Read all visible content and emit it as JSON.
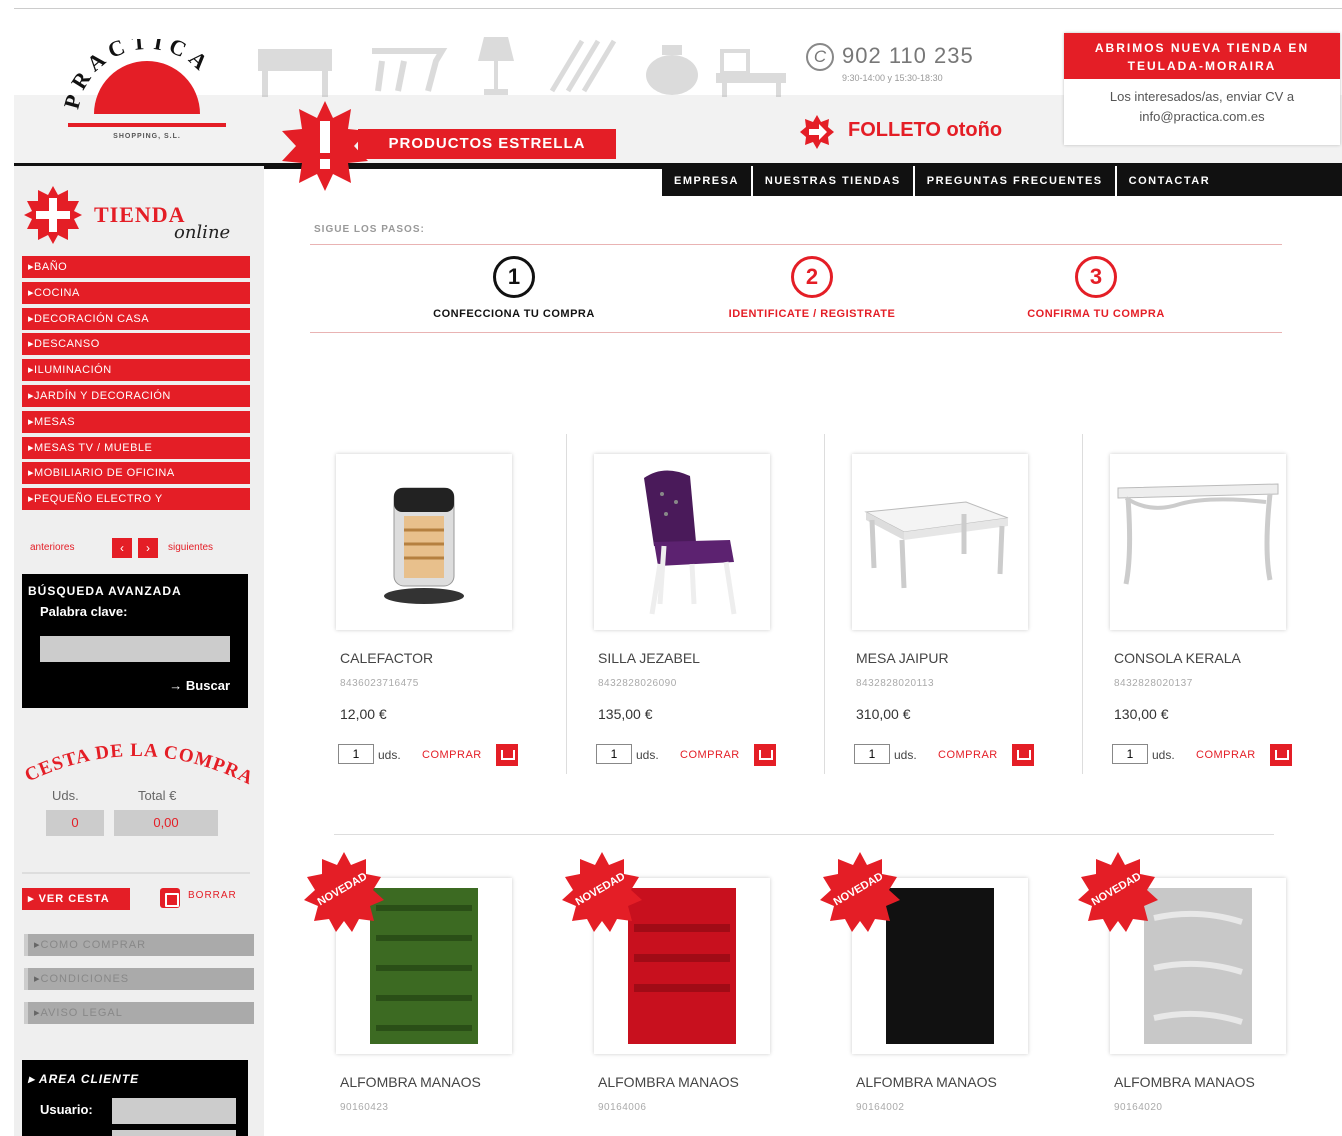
{
  "header": {
    "logo_text": "PRACTICA",
    "logo_sub": "SHOPPING, S.L.",
    "phone_number": "902 110 235",
    "phone_hours": "9:30-14:00 y 15:30-18:30",
    "promo_title": "ABRIMOS NUEVA TIENDA EN TEULADA-MORAIRA",
    "promo_body": "Los interesados/as, enviar CV a info@practica.com.es",
    "estrella_label": "PRODUCTOS ESTRELLA",
    "folleto_label": "FOLLETO otoño"
  },
  "top_nav": [
    "EMPRESA",
    "NUESTRAS TIENDAS",
    "PREGUNTAS FRECUENTES",
    "CONTACTAR"
  ],
  "sidebar": {
    "tienda_word": "TIENDA",
    "tienda_online": "online",
    "categories": [
      "BAÑO",
      "COCINA",
      "DECORACIÓN CASA",
      "DESCANSO",
      "ILUMINACIÓN",
      "JARDÍN Y DECORACIÓN",
      "MESAS",
      "MESAS TV / MUEBLE",
      "MOBILIARIO DE OFICINA",
      "PEQUEÑO ELECTRO Y"
    ],
    "pager_prev": "anteriores",
    "pager_next": "siguientes",
    "search_title": "BÚSQUEDA AVANZADA",
    "search_keyword_label": "Palabra clave:",
    "search_button": "Buscar",
    "cart_title": "CESTA DE LA COMPRA",
    "cart_uds_label": "Uds.",
    "cart_total_label": "Total €",
    "cart_uds_value": "0",
    "cart_total_value": "0,00",
    "ver_cesta": "VER CESTA",
    "borrar": "BORRAR",
    "info_links": [
      "COMO COMPRAR",
      "CONDICIONES",
      "AVISO LEGAL"
    ],
    "client_title": "AREA CLIENTE",
    "client_user_label": "Usuario:"
  },
  "steps": {
    "title": "SIGUE LOS PASOS:",
    "items": [
      {
        "num": "1",
        "label": "CONFECCIONA TU COMPRA"
      },
      {
        "num": "2",
        "label": "IDENTIFICATE / REGISTRATE"
      },
      {
        "num": "3",
        "label": "CONFIRMA TU COMPRA"
      }
    ]
  },
  "products": [
    {
      "name": "CALEFACTOR",
      "ref": "8436023716475",
      "price": "12,00 €",
      "qty": "1",
      "uds": "uds.",
      "buy": "COMPRAR",
      "new": false
    },
    {
      "name": "SILLA JEZABEL",
      "ref": "8432828026090",
      "price": "135,00 €",
      "qty": "1",
      "uds": "uds.",
      "buy": "COMPRAR",
      "new": false
    },
    {
      "name": "MESA JAIPUR",
      "ref": "8432828020113",
      "price": "310,00 €",
      "qty": "1",
      "uds": "uds.",
      "buy": "COMPRAR",
      "new": false
    },
    {
      "name": "CONSOLA KERALA",
      "ref": "8432828020137",
      "price": "130,00 €",
      "qty": "1",
      "uds": "uds.",
      "buy": "COMPRAR",
      "new": false
    },
    {
      "name": "ALFOMBRA       MANAOS",
      "ref": "90160423",
      "new": true,
      "badge": "NOVEDAD"
    },
    {
      "name": "ALFOMBRA       MANAOS",
      "ref": "90164006",
      "new": true,
      "badge": "NOVEDAD"
    },
    {
      "name": "ALFOMBRA       MANAOS",
      "ref": "90164002",
      "new": true,
      "badge": "NOVEDAD"
    },
    {
      "name": "ALFOMBRA       MANAOS",
      "ref": "90164020",
      "new": true,
      "badge": "NOVEDAD"
    }
  ],
  "colors": {
    "brand_red": "#e41e26",
    "dark": "#111111"
  }
}
